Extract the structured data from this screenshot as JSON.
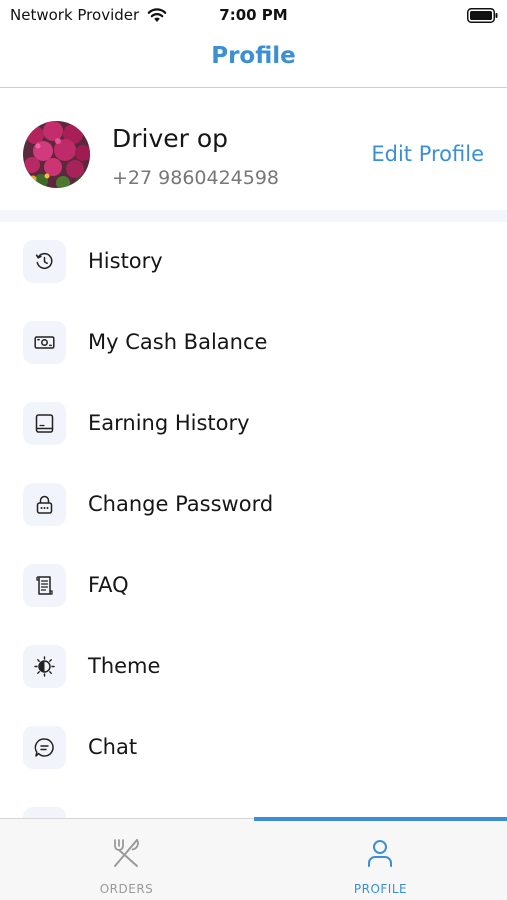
{
  "status_bar": {
    "carrier": "Network Provider",
    "time": "7:00 PM",
    "icons": [
      "wifi-icon",
      "battery-icon"
    ]
  },
  "header": {
    "title": "Profile"
  },
  "profile": {
    "name": "Driver op",
    "phone": "+27 9860424598",
    "edit_label": "Edit Profile",
    "avatar": "flower-photo"
  },
  "menu": {
    "items": [
      {
        "label": "History",
        "icon": "history-icon"
      },
      {
        "label": "My Cash Balance",
        "icon": "cash-icon"
      },
      {
        "label": "Earning History",
        "icon": "earning-icon"
      },
      {
        "label": "Change Password",
        "icon": "lock-icon"
      },
      {
        "label": "FAQ",
        "icon": "faq-icon"
      },
      {
        "label": "Theme",
        "icon": "theme-icon"
      },
      {
        "label": "Chat",
        "icon": "chat-icon"
      }
    ]
  },
  "tabs": [
    {
      "label": "ORDERS",
      "icon": "fork-knife-icon",
      "active": false
    },
    {
      "label": "PROFILE",
      "icon": "person-icon",
      "active": true
    }
  ],
  "colors": {
    "accent": "#3d8fd4",
    "icon_bg": "#f1f4fa",
    "divider": "#cfcfcf",
    "tab_inactive": "#9a9a9a"
  }
}
